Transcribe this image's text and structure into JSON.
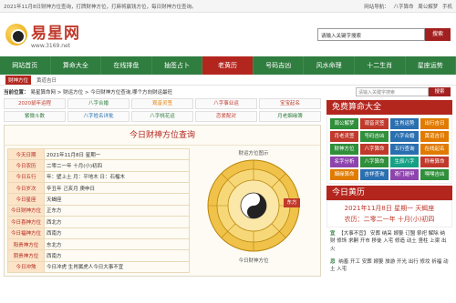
{
  "topbar": {
    "left": "2021年11月8日财神方位查询，打牌财神方位，打麻将赢钱方位，每日财神方位查询。",
    "right_label": "网站导航：",
    "right_links": [
      "八字算命",
      "周公解梦",
      "手机"
    ]
  },
  "header": {
    "brand": "易星网",
    "url": "www.3169.net",
    "search_placeholder": "请输入关键字搜索",
    "search_button": "搜索"
  },
  "nav": [
    "网站首页",
    "算命大全",
    "在线排盘",
    "抽签占卜",
    "老黄历",
    "号码吉凶",
    "风水命理",
    "十二生肖",
    "星座运势"
  ],
  "subnav": {
    "active": "财神方位",
    "other": "黄道吉日"
  },
  "breadcrumb": {
    "label": "当前位置：",
    "path": "易星算命网 > 财运方位 > 今日财神方位查询,哪个方向财运最旺",
    "search_placeholder": "请输入关键字搜索",
    "search_button": "搜索"
  },
  "quicklinks": [
    {
      "label": "2020鼠年运程",
      "color": "red"
    },
    {
      "label": "八字合婚",
      "color": "grn"
    },
    {
      "label": "观音灵签",
      "color": "org"
    },
    {
      "label": "八字事业运",
      "color": "red"
    },
    {
      "label": "宝宝起名",
      "color": "red"
    },
    {
      "label": "紫微斗数",
      "color": "grn"
    },
    {
      "label": "八字姓名详批",
      "color": "blue"
    },
    {
      "label": "八字桃花运",
      "color": "grn"
    },
    {
      "label": "恋爱配对",
      "color": "red"
    },
    {
      "label": "月老姻缘簿",
      "color": "grn"
    }
  ],
  "panel": {
    "title": "今日财神方位查询",
    "rows": [
      {
        "k": "今天日期",
        "v": "2021年11月8日 星期一"
      },
      {
        "k": "今日农历",
        "v": "二零二一年 十月(小)初四"
      },
      {
        "k": "今日五行",
        "v": "年：壁上土 月：平地木 日：石榴木"
      },
      {
        "k": "今日岁次",
        "v": "辛丑年 己亥月 庚申日"
      },
      {
        "k": "今日星座",
        "v": "天蝎座"
      },
      {
        "k": "今日财神方位",
        "v": "正东方"
      },
      {
        "k": "今日喜神方位",
        "v": "西北方"
      },
      {
        "k": "今日福神方位",
        "v": "西南方"
      },
      {
        "k": "阳贵神方位",
        "v": "东北方"
      },
      {
        "k": "阴贵神方位",
        "v": "西南方"
      },
      {
        "k": "今日冲煞",
        "v": "今日冲虎 生肖属虎人今日大事不宜"
      }
    ],
    "compass_caption": "财运方位图示",
    "compass_footer": "今日财神方位",
    "compass_label": "东方"
  },
  "sidebar": {
    "tools_title": "免费算命大全",
    "tools": [
      {
        "label": "周公解梦",
        "c": "g"
      },
      {
        "label": "观音灵签",
        "c": "r"
      },
      {
        "label": "生肖运势",
        "c": "b"
      },
      {
        "label": "出行吉日",
        "c": "o"
      },
      {
        "label": "月老灵签",
        "c": "r"
      },
      {
        "label": "号码吉凶",
        "c": "g"
      },
      {
        "label": "八字合婚",
        "c": "b"
      },
      {
        "label": "黄道吉日",
        "c": "o"
      },
      {
        "label": "财神方位",
        "c": "g"
      },
      {
        "label": "八字算命",
        "c": "r"
      },
      {
        "label": "五行查询",
        "c": "b"
      },
      {
        "label": "在线起名",
        "c": "o"
      },
      {
        "label": "名字分析",
        "c": "p"
      },
      {
        "label": "八字算命",
        "c": "g"
      },
      {
        "label": "生辰八字",
        "c": "c"
      },
      {
        "label": "称骨算命",
        "c": "r"
      },
      {
        "label": "姻缘算命",
        "c": "o"
      },
      {
        "label": "吉祥查询",
        "c": "b"
      },
      {
        "label": "奇门遁甲",
        "c": "p"
      },
      {
        "label": "嘿嘿吉凶",
        "c": "g"
      }
    ],
    "huangli_title": "今日黄历",
    "huangli_date": "2021年11月8日 星期一 天蝎座",
    "huangli_lunar": "农历：二零二一年 十月(小)初四",
    "yi_tag": "宜",
    "yi": "【大事不宜】 安葬 纳采 嫁娶 订盟 祭祀 解除 纳财 修饰 求嗣 开市 移徙 入宅 修造 动土 竖柱 上梁 出火",
    "ji_tag": "忌",
    "ji": "纳畜 开工 安葬 嫁娶 旅游 开光 出行 修坟 祈福 动土 入宅"
  }
}
